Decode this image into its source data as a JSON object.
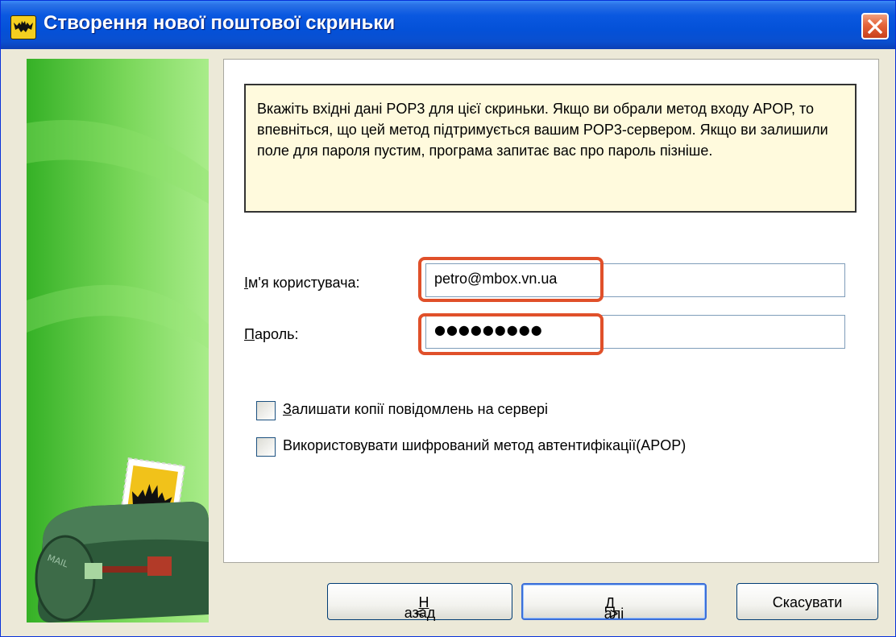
{
  "window": {
    "title": "Створення нової поштової скриньки"
  },
  "info": {
    "text": "Вкажіть вхідні дані POP3 для цієї скриньки. Якщо ви обрали метод входу APOP, то впевніться, що цей метод підтримується вашим POP3-сервером. Якщо ви залишили поле для пароля пустим, програма запитає вас про пароль пізніше."
  },
  "form": {
    "username_label_key": "І",
    "username_label_rest": "м'я користувача:",
    "username_value": "petro@mbox.vn.ua",
    "password_label_key": "П",
    "password_label_rest": "ароль:",
    "password_value": "●●●●●●●●●"
  },
  "options": {
    "keep_copies_key": "З",
    "keep_copies_rest": "алишати копії повідомлень на сервері",
    "keep_copies_checked": false,
    "apop_label": "Використовувати шифрований метод автентифікації(APOP)",
    "apop_checked": false
  },
  "buttons": {
    "back_prefix": "<",
    "back_key": "Н",
    "back_rest": "азад",
    "next_key": "Д",
    "next_rest": "алі",
    "next_suffix": ">",
    "cancel": "Скасувати"
  },
  "colors": {
    "titlebar": "#0a58e0",
    "highlight": "#e0502a",
    "info_bg": "#fffadd",
    "side_green": "#5cc840"
  },
  "icons": {
    "app": "bat-icon",
    "close": "close-icon",
    "sidebar": "mailbox-illustration"
  }
}
